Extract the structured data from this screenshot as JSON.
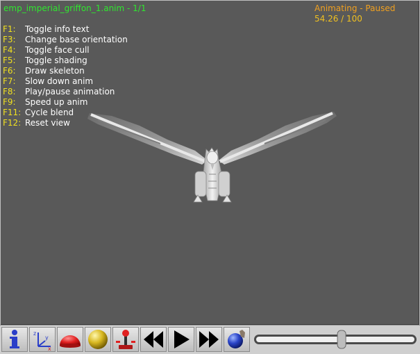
{
  "viewport": {
    "title": "emp_imperial_griffon_1.anim - 1/1",
    "status": "Animating - Paused",
    "progress_text": "54.26 / 100",
    "colors": {
      "background": "#595959",
      "title": "#2ee82e",
      "status": "#f0a020",
      "key": "#f0e020",
      "text": "#ffffff"
    }
  },
  "shortcuts": [
    {
      "key": "F1:",
      "label": "Toggle info text"
    },
    {
      "key": "F3:",
      "label": "Change base orientation"
    },
    {
      "key": "F4:",
      "label": "Toggle face cull"
    },
    {
      "key": "F5:",
      "label": "Toggle shading"
    },
    {
      "key": "F6:",
      "label": "Draw skeleton"
    },
    {
      "key": "F7:",
      "label": "Slow down anim"
    },
    {
      "key": "F8:",
      "label": "Play/pause animation"
    },
    {
      "key": "F9:",
      "label": "Speed up anim"
    },
    {
      "key": "F11:",
      "label": "Cycle blend"
    },
    {
      "key": "F12:",
      "label": "Reset view"
    }
  ],
  "toolbar": {
    "buttons": [
      {
        "name": "info-button",
        "icon": "info-icon"
      },
      {
        "name": "axes-button",
        "icon": "axes-icon"
      },
      {
        "name": "hemisphere-button",
        "icon": "red-hemisphere-icon"
      },
      {
        "name": "sphere-button",
        "icon": "yellow-sphere-icon"
      },
      {
        "name": "joystick-button",
        "icon": "joystick-icon"
      },
      {
        "name": "rewind-button",
        "icon": "rewind-icon"
      },
      {
        "name": "play-button",
        "icon": "play-icon"
      },
      {
        "name": "fast-forward-button",
        "icon": "fast-forward-icon"
      },
      {
        "name": "light-button",
        "icon": "globe-hand-icon"
      }
    ],
    "timeline_position": 0.5426
  }
}
